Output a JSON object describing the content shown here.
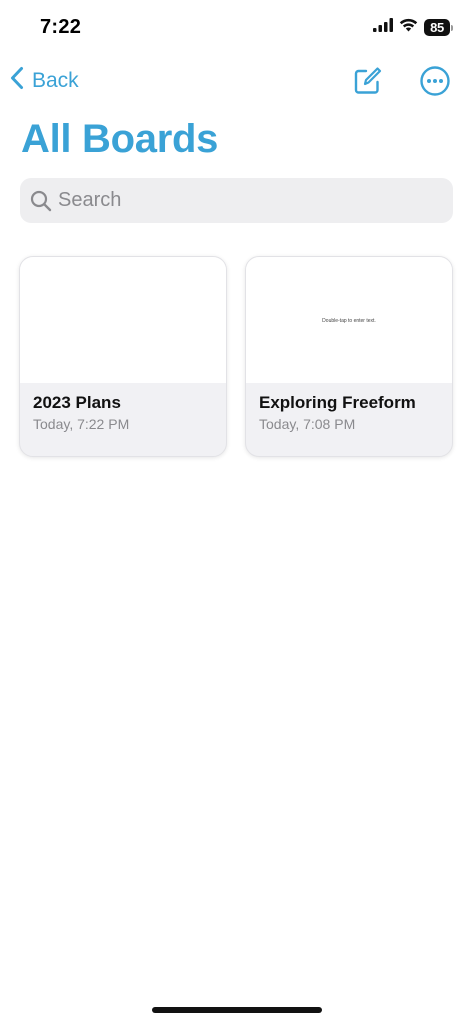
{
  "status_bar": {
    "time": "7:22",
    "battery": "85"
  },
  "nav": {
    "back_label": "Back",
    "compose_icon": "square-and-pencil-icon",
    "more_icon": "ellipsis-circle-icon"
  },
  "page_title": "All Boards",
  "search": {
    "placeholder": "Search",
    "value": ""
  },
  "boards": [
    {
      "title": "2023 Plans",
      "date": "Today, 7:22 PM",
      "thumb_text": ""
    },
    {
      "title": "Exploring Freeform",
      "date": "Today, 7:08 PM",
      "thumb_text": "Double-tap to enter text."
    }
  ],
  "colors": {
    "accent": "#3aa2d6",
    "search_bg": "#eeeef0",
    "card_footer_bg": "#f1f1f4",
    "secondary_text": "#8a8a8e"
  }
}
